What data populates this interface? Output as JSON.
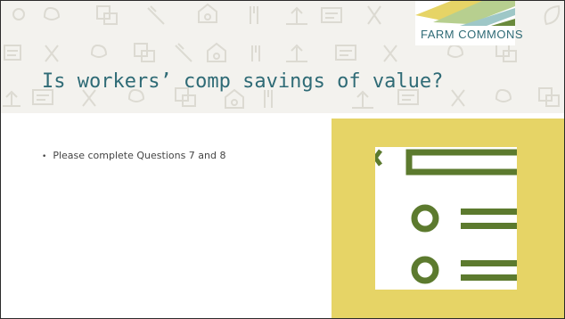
{
  "slide": {
    "title": "Is workers’ comp savings of value?",
    "bullets": [
      "Please complete Questions 7 and 8"
    ],
    "bullet_glyph": "•"
  },
  "logo": {
    "text": "FARM COMMONS",
    "colors": [
      "#2f6b76",
      "#e6d466",
      "#6a8a3c"
    ]
  },
  "colors": {
    "title": "#2f6b76",
    "header_bg": "#f3f2ee",
    "panel": "#e6d466",
    "checklist_green": "#5c7a2e"
  },
  "icons": {
    "header_pattern": "farm-pattern",
    "checklist": "checklist-icon"
  }
}
